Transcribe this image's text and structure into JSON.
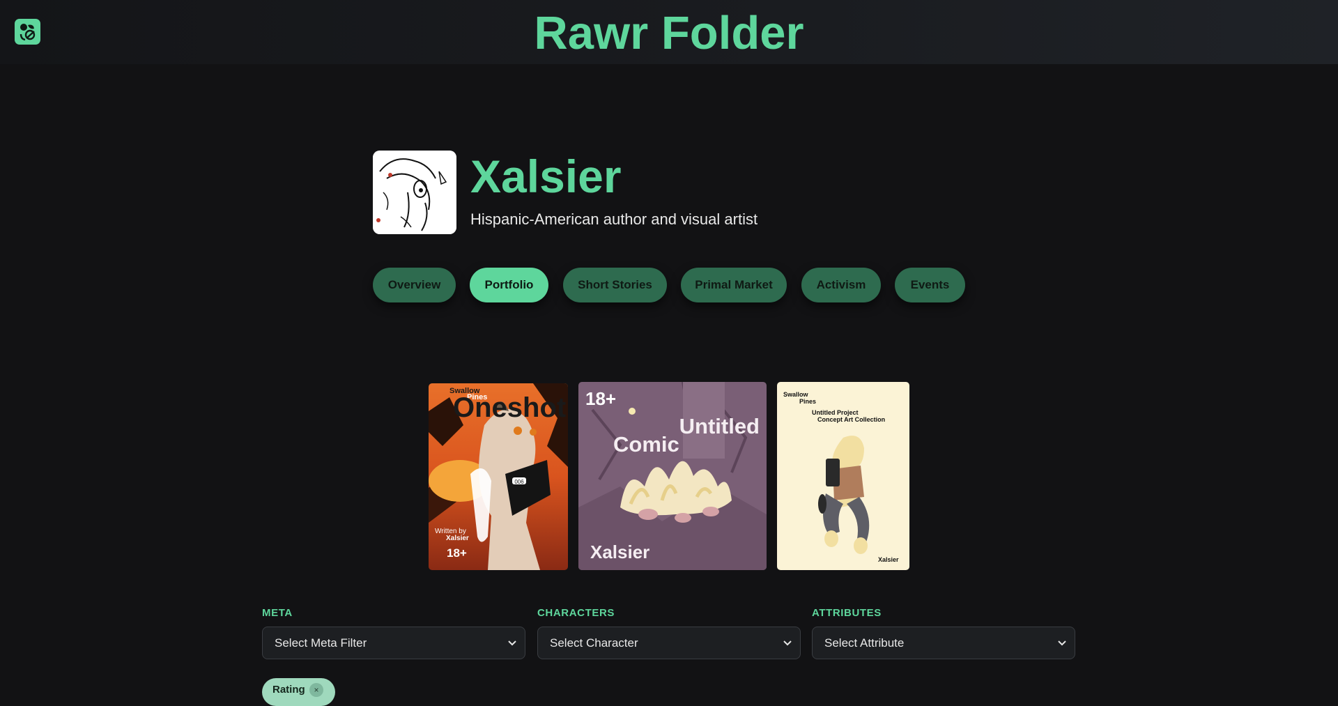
{
  "header": {
    "title": "Rawr Folder",
    "logo_icon": "leaf-swap-icon",
    "accent_color": "#5ed69c"
  },
  "profile": {
    "name": "Xalsier",
    "bio": "Hispanic-American author and visual artist",
    "avatar_icon": "character-sketch-avatar"
  },
  "tabs": [
    {
      "label": "Overview",
      "active": false
    },
    {
      "label": "Portfolio",
      "active": true
    },
    {
      "label": "Short Stories",
      "active": false
    },
    {
      "label": "Primal Market",
      "active": false
    },
    {
      "label": "Activism",
      "active": false
    },
    {
      "label": "Events",
      "active": false
    }
  ],
  "portfolio": [
    {
      "series": "Swallow\nPines",
      "series_line1": "Swallow",
      "series_line2": "Pines",
      "title": "Oneshot",
      "byline": "Written by",
      "author": "Xalsier",
      "rating": "18+",
      "badge": "006"
    },
    {
      "rating": "18+",
      "title_line1": "Untitled",
      "title_line2": "Comic",
      "author": "Xalsier"
    },
    {
      "series_line1": "Swallow",
      "series_line2": "Pines",
      "title_line1": "Untitled Project",
      "title_line2": "Concept Art Collection",
      "author": "Xalsier"
    }
  ],
  "filters": {
    "meta": {
      "label": "META",
      "value": "Select Meta Filter"
    },
    "characters": {
      "label": "CHARACTERS",
      "value": "Select Character"
    },
    "attributes": {
      "label": "ATTRIBUTES",
      "value": "Select Attribute"
    }
  },
  "active_chips": [
    {
      "label": "Rating",
      "remove": "×"
    }
  ]
}
